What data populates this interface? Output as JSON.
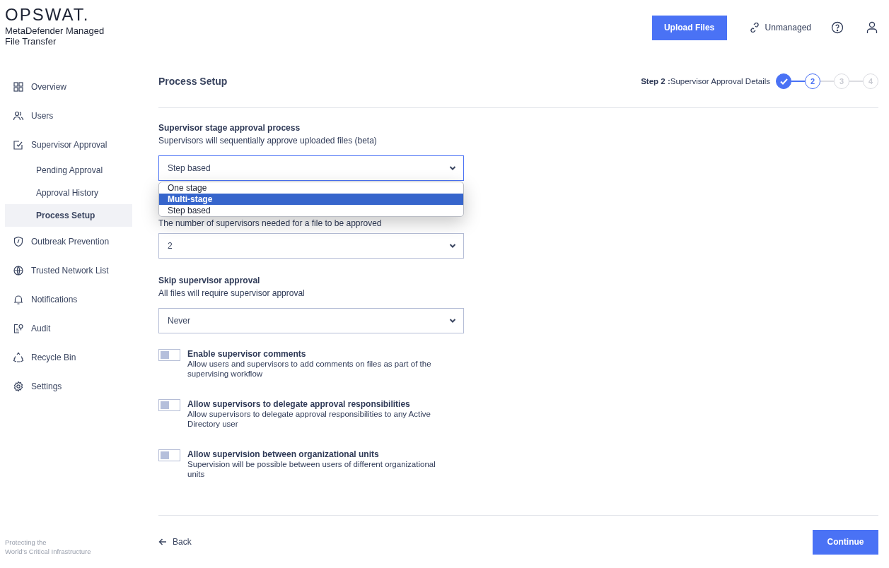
{
  "brand": {
    "logo": "OPSWAT.",
    "product": "MetaDefender Managed File Transfer"
  },
  "header": {
    "upload_button": "Upload Files",
    "license": "Unmanaged"
  },
  "sidebar": {
    "items": [
      {
        "label": "Overview",
        "selected": false
      },
      {
        "label": "Users",
        "selected": false
      },
      {
        "label": "Supervisor Approval",
        "selected": false,
        "children": [
          {
            "label": "Pending Approval",
            "selected": false
          },
          {
            "label": "Approval History",
            "selected": false
          },
          {
            "label": "Process Setup",
            "selected": true
          }
        ]
      },
      {
        "label": "Outbreak Prevention",
        "selected": false
      },
      {
        "label": "Trusted Network List",
        "selected": false
      },
      {
        "label": "Notifications",
        "selected": false
      },
      {
        "label": "Audit",
        "selected": false
      },
      {
        "label": "Recycle Bin",
        "selected": false
      },
      {
        "label": "Settings",
        "selected": false
      }
    ],
    "footer": [
      "Protecting the",
      "World's Critical Infrastructure"
    ]
  },
  "page": {
    "title": "Process Setup",
    "step_prefix": "Step 2 :",
    "step_title": "Supervisor Approval Details",
    "steps": [
      {
        "kind": "done"
      },
      {
        "label": "2",
        "kind": "current"
      },
      {
        "label": "3",
        "kind": "upcoming"
      },
      {
        "label": "4",
        "kind": "upcoming"
      }
    ]
  },
  "fields": [
    {
      "label": "Supervisor stage approval process",
      "description": "Supervisors will sequentially approve uploaded files (beta)",
      "value": "Step based",
      "focused": true,
      "options": [
        {
          "label": "One stage",
          "highlighted": false
        },
        {
          "label": "Multi-stage",
          "highlighted": true
        },
        {
          "label": "Step based",
          "highlighted": false
        }
      ]
    },
    {
      "description": "The number of supervisors needed for a file to be approved",
      "value": "2",
      "focused": false
    },
    {
      "label": "Skip supervisor approval",
      "description": "All files will require supervisor approval",
      "value": "Never",
      "focused": false
    }
  ],
  "toggles": [
    {
      "title": "Enable supervisor comments",
      "description": "Allow users and supervisors to add comments on files as part of the supervising workflow",
      "on": false
    },
    {
      "title": "Allow supervisors to delegate approval responsibilities",
      "description": "Allow supervisors to delegate approval responsibilities to any Active Directory user",
      "on": false
    },
    {
      "title": "Allow supervision between organizational units",
      "description": "Supervision will be possible between users of different organizational units",
      "on": false
    }
  ],
  "footer": {
    "back": "Back",
    "continue": "Continue"
  }
}
